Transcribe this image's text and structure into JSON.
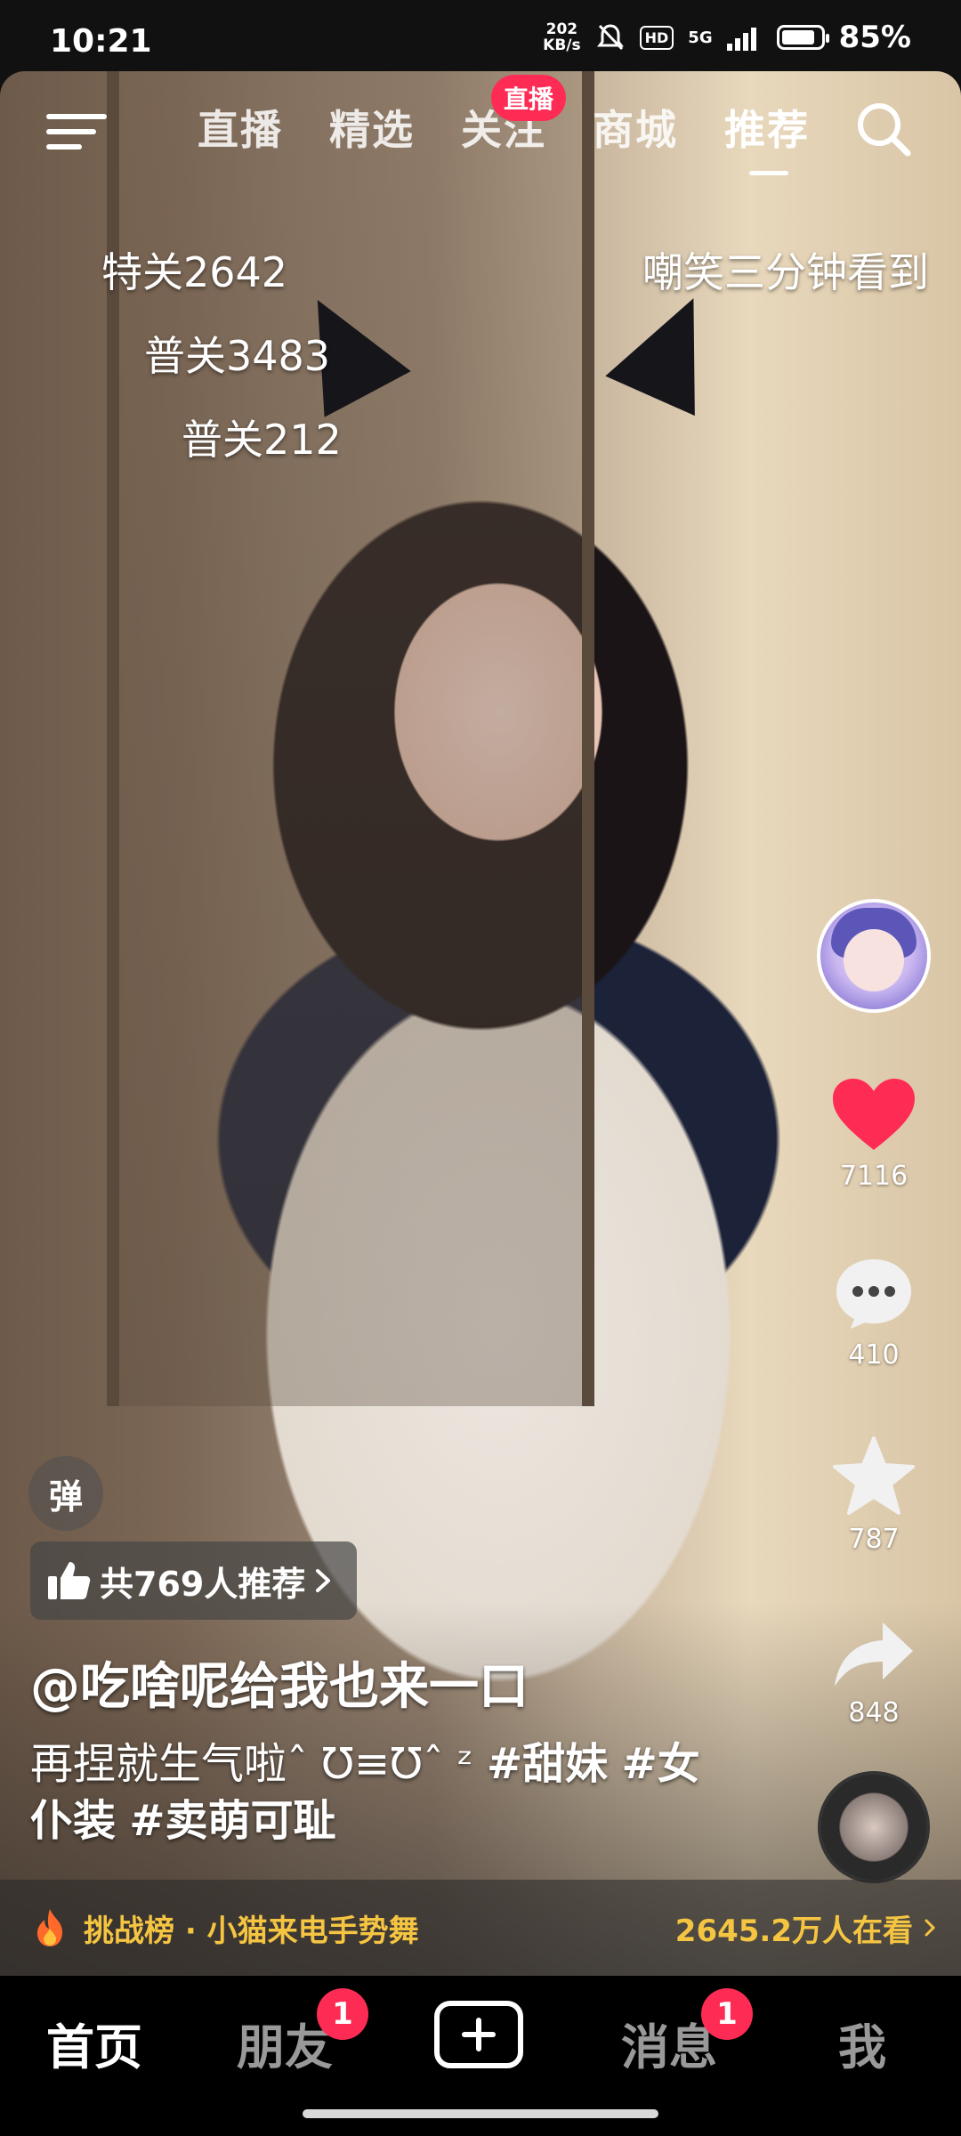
{
  "status_bar": {
    "time": "10:21",
    "net_speed_value": "202",
    "net_speed_unit": "KB/s",
    "hd": "HD",
    "network": "5G",
    "battery_percent": "85%",
    "battery_level": 0.85
  },
  "top_nav": {
    "tabs": [
      {
        "label": "直播"
      },
      {
        "label": "精选"
      },
      {
        "label": "关注"
      },
      {
        "label": "商城"
      },
      {
        "label": "推荐"
      }
    ],
    "active_tab": "推荐",
    "live_badge": "直播"
  },
  "danmaku": [
    {
      "text": "特关2642"
    },
    {
      "text": "普关3483"
    },
    {
      "text": "普关212"
    },
    {
      "text": "嘲笑三分钟看到"
    }
  ],
  "actions": {
    "likes": "7116",
    "comments": "410",
    "favorites": "787",
    "shares": "848"
  },
  "video_info": {
    "danmu_toggle": "弹",
    "recommend_text": "共769人推荐",
    "author": "@吃啥呢给我也来一口",
    "caption_text": "再捏就生气啦ˆ Ʊ≡Ʊˆ ᶻ ",
    "hashtags": [
      "#甜妹",
      "#女仆装",
      "#卖萌可耻"
    ]
  },
  "challenge": {
    "text": "挑战榜 · 小猫来电手势舞",
    "viewers": "2645.2万人在看"
  },
  "bottom_nav": {
    "items": [
      {
        "label": "首页"
      },
      {
        "label": "朋友",
        "badge": "1"
      },
      {
        "label": "消息",
        "badge": "1"
      },
      {
        "label": "我"
      }
    ]
  },
  "colors": {
    "accent": "#fe2c55",
    "challenge": "#f5c542"
  }
}
